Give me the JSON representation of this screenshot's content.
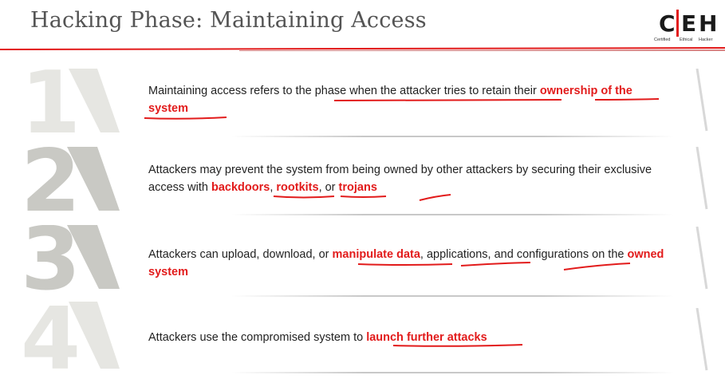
{
  "header": {
    "title": "Hacking Phase: Maintaining Access",
    "logo": {
      "letters": [
        "C",
        "E",
        "H"
      ],
      "caption": [
        "Certified",
        "Ethical",
        "Hacker"
      ]
    }
  },
  "items": [
    {
      "number": "1",
      "segments": [
        {
          "text": "Maintaining access refers to the phase when the attacker tries to retain their ",
          "hl": false
        },
        {
          "text": "ownership of the system",
          "hl": true
        }
      ]
    },
    {
      "number": "2",
      "segments": [
        {
          "text": "Attackers may prevent the system from being owned by other attackers by securing their exclusive access with ",
          "hl": false
        },
        {
          "text": "backdoors",
          "hl": true
        },
        {
          "text": ", ",
          "hl": false
        },
        {
          "text": "rootkits",
          "hl": true
        },
        {
          "text": ", or ",
          "hl": false
        },
        {
          "text": "trojans",
          "hl": true
        }
      ]
    },
    {
      "number": "3",
      "segments": [
        {
          "text": "Attackers can upload, download, or ",
          "hl": false
        },
        {
          "text": "manipulate data",
          "hl": true
        },
        {
          "text": ", applications, and configurations on the ",
          "hl": false
        },
        {
          "text": "owned system",
          "hl": true
        }
      ]
    },
    {
      "number": "4",
      "segments": [
        {
          "text": "Attackers use the compromised system to ",
          "hl": false
        },
        {
          "text": "launch further attacks",
          "hl": true
        }
      ]
    }
  ],
  "colors": {
    "accent_red": "#e21b1b",
    "title_gray": "#545454",
    "numeral_gray": "#c9c9c4",
    "numeral_light": "#e6e6e2",
    "body_text": "#222222"
  },
  "icons": [
    "ceh-logo",
    "numeral-1-icon",
    "numeral-2-icon",
    "numeral-3-icon",
    "numeral-4-icon"
  ]
}
